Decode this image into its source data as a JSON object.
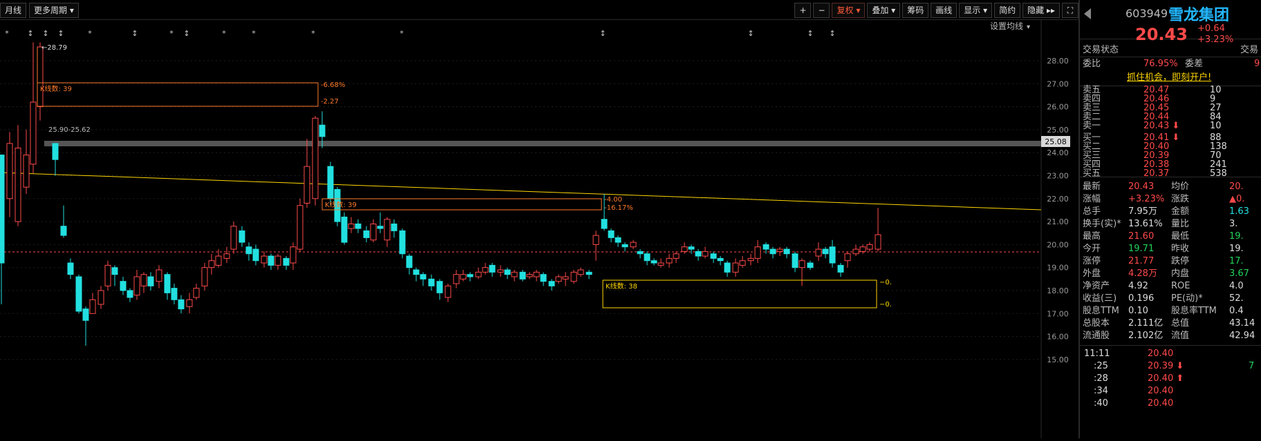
{
  "toolbar": {
    "left": [
      "月线",
      "更多周期"
    ],
    "right": [
      "+",
      "−",
      "复权",
      "叠加",
      "筹码",
      "画线",
      "显示",
      "简约",
      "隐藏",
      "⛶"
    ],
    "setting_label": "设置均线"
  },
  "chart": {
    "price_axis": [
      "28.00",
      "27.00",
      "26.00",
      "25.00",
      "24.00",
      "23.00",
      "22.00",
      "21.00",
      "20.00",
      "19.00",
      "18.00",
      "17.00",
      "16.00",
      "15.00"
    ],
    "current_price_tag": "25.08",
    "high_label": "28.79",
    "range_label": "25.90-25.62",
    "box1_label": "K线数: 39",
    "box1_pct": "-6.68%",
    "box1_val": "-2.27",
    "box2_label": "K线数: 39",
    "box2_pct": "-16.17%",
    "box2_val": "-4.00",
    "box3_label": "K线数: 38",
    "box3_val1": "0.",
    "box3_val2": "0."
  },
  "quote": {
    "code": "603949",
    "name": "雪龙集团",
    "price": "20.43",
    "change": "+0.64",
    "change_pct": "+3.23%",
    "status_label": "交易状态",
    "status_label2": "交易",
    "weibi_label": "委比",
    "weibi": "76.95%",
    "weicha_label": "委差",
    "weicha": "9",
    "promo": "抓住机会，即刻开户!",
    "asks": [
      {
        "label": "卖五",
        "price": "20.47",
        "vol": "10"
      },
      {
        "label": "卖四",
        "price": "20.46",
        "vol": "9"
      },
      {
        "label": "卖三",
        "price": "20.45",
        "vol": "27"
      },
      {
        "label": "卖二",
        "price": "20.44",
        "vol": "84"
      },
      {
        "label": "卖一",
        "price": "20.43",
        "vol": "10"
      }
    ],
    "bids": [
      {
        "label": "买一",
        "price": "20.41",
        "vol": "88"
      },
      {
        "label": "买二",
        "price": "20.40",
        "vol": "138"
      },
      {
        "label": "买三",
        "price": "20.39",
        "vol": "70"
      },
      {
        "label": "买四",
        "price": "20.38",
        "vol": "241"
      },
      {
        "label": "买五",
        "price": "20.37",
        "vol": "538"
      }
    ],
    "stats": [
      {
        "l1": "最新",
        "v1": "20.43",
        "c1": "red",
        "l2": "均价",
        "v2": "20.",
        "c2": "red"
      },
      {
        "l1": "涨幅",
        "v1": "+3.23%",
        "c1": "red",
        "l2": "涨跌",
        "v2": "▲0.",
        "c2": "red"
      },
      {
        "l1": "总手",
        "v1": "7.95万",
        "c1": "white",
        "l2": "金额",
        "v2": "1.63",
        "c2": "cyan"
      },
      {
        "l1": "换手(实)*",
        "v1": "13.61%",
        "c1": "white",
        "l2": "量比",
        "v2": "3.",
        "c2": "white"
      },
      {
        "l1": "最高",
        "v1": "21.60",
        "c1": "red",
        "l2": "最低",
        "v2": "19.",
        "c2": "green"
      },
      {
        "l1": "今开",
        "v1": "19.71",
        "c1": "green",
        "l2": "昨收",
        "v2": "19.",
        "c2": "white"
      },
      {
        "l1": "涨停",
        "v1": "21.77",
        "c1": "red",
        "l2": "跌停",
        "v2": "17.",
        "c2": "green"
      },
      {
        "l1": "外盘",
        "v1": "4.28万",
        "c1": "red",
        "l2": "内盘",
        "v2": "3.67",
        "c2": "green"
      },
      {
        "l1": "净资产",
        "v1": "4.92",
        "c1": "white",
        "l2": "ROE",
        "v2": "4.0",
        "c2": "white"
      },
      {
        "l1": "收益(三)",
        "v1": "0.196",
        "c1": "white",
        "l2": "PE(动)*",
        "v2": "52.",
        "c2": "white"
      },
      {
        "l1": "股息TTM",
        "v1": "0.10",
        "c1": "white",
        "l2": "股息率TTM",
        "v2": "0.4",
        "c2": "white"
      },
      {
        "l1": "总股本",
        "v1": "2.111亿",
        "c1": "white",
        "l2": "总值",
        "v2": "43.14",
        "c2": "white"
      },
      {
        "l1": "流通股",
        "v1": "2.102亿",
        "c1": "white",
        "l2": "流值",
        "v2": "42.94",
        "c2": "white"
      }
    ],
    "ticks": [
      {
        "time": "11:11",
        "price": "20.40",
        "dir": "",
        "vol": ""
      },
      {
        "time": ":25",
        "price": "20.39",
        "dir": "down",
        "vol": "7"
      },
      {
        "time": ":28",
        "price": "20.40",
        "dir": "up",
        "vol": ""
      },
      {
        "time": ":34",
        "price": "20.40",
        "dir": "",
        "vol": ""
      },
      {
        "time": ":40",
        "price": "20.40",
        "dir": "",
        "vol": ""
      }
    ]
  },
  "colors": {
    "up": "#ff4a4a",
    "down": "#22e0e0",
    "ma": "#ffd700",
    "box": "#ff7a2a",
    "grid": "#2a2a2a"
  }
}
